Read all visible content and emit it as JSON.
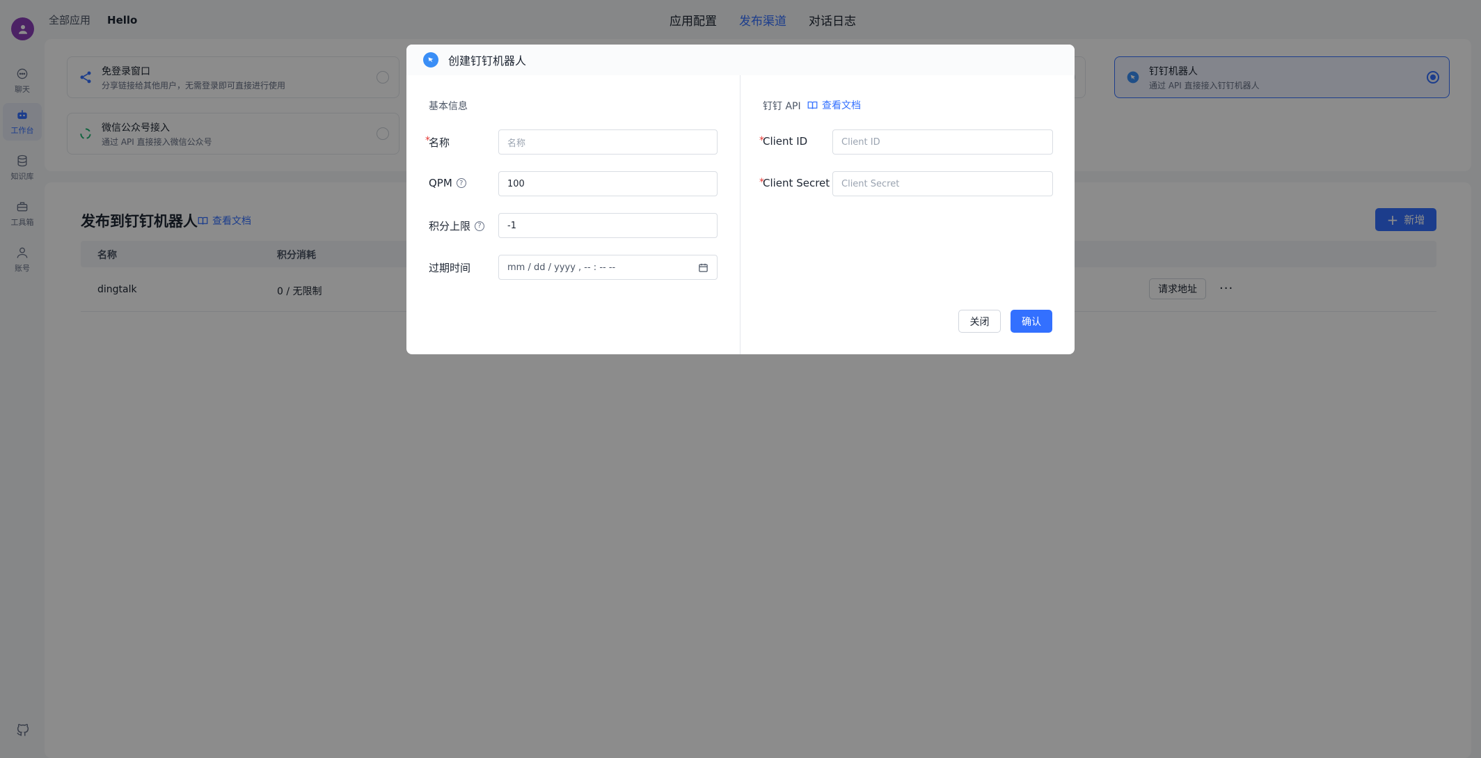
{
  "topbar": {
    "all_apps": "全部应用",
    "app_name": "Hello",
    "tabs": [
      "应用配置",
      "发布渠道",
      "对话日志"
    ],
    "active_tab": "发布渠道"
  },
  "sidebar": {
    "items": [
      {
        "label": "聊天",
        "icon": "chat-icon"
      },
      {
        "label": "工作台",
        "icon": "robot-icon"
      },
      {
        "label": "知识库",
        "icon": "database-icon"
      },
      {
        "label": "工具箱",
        "icon": "toolbox-icon"
      },
      {
        "label": "账号",
        "icon": "user-icon"
      }
    ],
    "active": "工作台"
  },
  "channels": [
    {
      "title": "免登录窗口",
      "desc": "分享链接给其他用户，无需登录即可直接进行使用",
      "icon": "share-icon",
      "selected": false
    },
    {
      "title": "微信公众号接入",
      "desc": "通过 API 直接接入微信公众号",
      "icon": "wechat-icon",
      "selected": false
    },
    {
      "title": "钉钉机器人",
      "desc": "通过 API 直接接入钉钉机器人",
      "icon": "dingtalk-icon",
      "selected": true
    }
  ],
  "section": {
    "title": "发布到钉钉机器人",
    "doc_link": "查看文档",
    "add_label": "新增"
  },
  "table": {
    "columns": [
      "名称",
      "积分消耗"
    ],
    "rows": [
      {
        "name": "dingtalk",
        "points": "0 / 无限制",
        "action": "请求地址",
        "more": "···"
      }
    ]
  },
  "modal": {
    "title": "创建钉钉机器人",
    "left": {
      "section": "基本信息",
      "fields": {
        "name_label": "名称",
        "name_placeholder": "名称",
        "qpm_label": "QPM",
        "qpm_value": "100",
        "points_label": "积分上限",
        "points_value": "-1",
        "expire_label": "过期时间",
        "expire_value": "mm / dd / yyyy ,  -- : --   --"
      }
    },
    "right": {
      "section": "钉钉 API",
      "doc_link": "查看文档",
      "client_id_label": "Client ID",
      "client_id_placeholder": "Client ID",
      "client_secret_label": "Client Secret",
      "client_secret_placeholder": "Client Secret"
    },
    "buttons": {
      "close": "关闭",
      "confirm": "确认"
    }
  },
  "colors": {
    "accent": "#3370ff",
    "required": "#e53935"
  }
}
